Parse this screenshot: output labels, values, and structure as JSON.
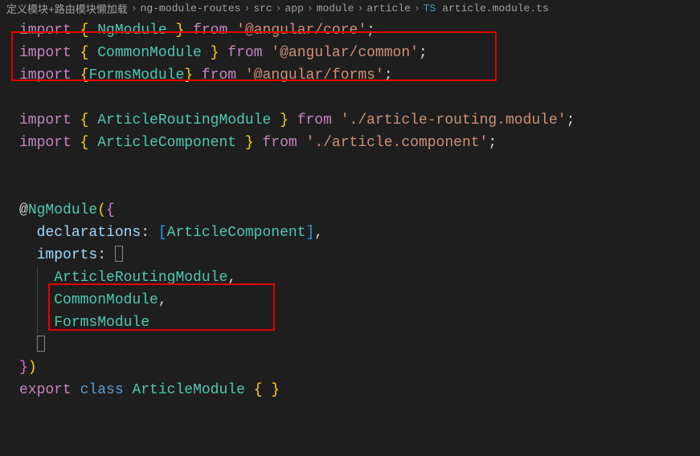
{
  "breadcrumb": {
    "items": [
      "定义模块+路由模块懒加载",
      "ng-module-routes",
      "src",
      "app",
      "module",
      "article",
      "article.module.ts"
    ]
  },
  "code": {
    "l1": {
      "kw": "import",
      "lb": "{ ",
      "name": "NgModule",
      "rb": " }",
      "from": "from",
      "str": "'@angular/core'",
      "semi": ";"
    },
    "l2": {
      "kw": "import",
      "lb": "{ ",
      "name": "CommonModule",
      "rb": " }",
      "from": "from",
      "str": "'@angular/common'",
      "semi": ";"
    },
    "l3": {
      "kw": "import",
      "lb": "{",
      "name": "FormsModule",
      "rb": "}",
      "from": "from",
      "str": "'@angular/forms'",
      "semi": ";"
    },
    "l5": {
      "kw": "import",
      "lb": "{ ",
      "name": "ArticleRoutingModule",
      "rb": " }",
      "from": "from",
      "str": "'./article-routing.module'",
      "semi": ";"
    },
    "l6": {
      "kw": "import",
      "lb": "{ ",
      "name": "ArticleComponent",
      "rb": " }",
      "from": "from",
      "str": "'./article.component'",
      "semi": ";"
    },
    "l9a": "@",
    "l9b": "NgModule",
    "l9c": "(",
    "l9d": "{",
    "l10a": "declarations",
    "l10b": ": ",
    "l10c": "[",
    "l10d": "ArticleComponent",
    "l10e": "]",
    "l10f": ",",
    "l11a": "imports",
    "l11b": ": ",
    "l11c": "[",
    "l12": "ArticleRoutingModule",
    "l12b": ",",
    "l13": "CommonModule",
    "l13b": ",",
    "l14": "FormsModule",
    "l15": "]",
    "l16a": "}",
    "l16b": ")",
    "l17a": "export",
    "l17b": "class",
    "l17c": "ArticleModule",
    "l17d": "{ }"
  }
}
